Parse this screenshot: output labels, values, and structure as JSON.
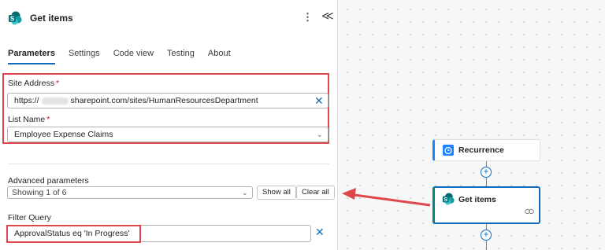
{
  "panel": {
    "title": "Get items",
    "more_icon": "⋮",
    "collapse_icon": "≪",
    "tabs": [
      {
        "label": "Parameters",
        "active": true
      },
      {
        "label": "Settings"
      },
      {
        "label": "Code view"
      },
      {
        "label": "Testing"
      },
      {
        "label": "About"
      }
    ]
  },
  "fields": {
    "site_address": {
      "label": "Site Address",
      "required": "*",
      "value_prefix": "https://",
      "value_suffix": "sharepoint.com/sites/HumanResourcesDepartment"
    },
    "list_name": {
      "label": "List Name",
      "required": "*",
      "value": "Employee Expense Claims"
    },
    "advanced": {
      "label": "Advanced parameters",
      "value": "Showing 1 of 6",
      "show_all": "Show all",
      "clear_all": "Clear all"
    },
    "filter_query": {
      "label": "Filter Query",
      "value": "ApprovalStatus eq 'In Progress'"
    }
  },
  "flow": {
    "nodes": [
      {
        "title": "Recurrence",
        "icon": "clock-icon"
      },
      {
        "title": "Get items",
        "icon": "sharepoint-icon",
        "selected": true
      }
    ]
  },
  "colors": {
    "accent": "#0f6cbd",
    "highlight": "#e0474c",
    "sharepoint": "#038387",
    "recurrence": "#1f85ff"
  }
}
